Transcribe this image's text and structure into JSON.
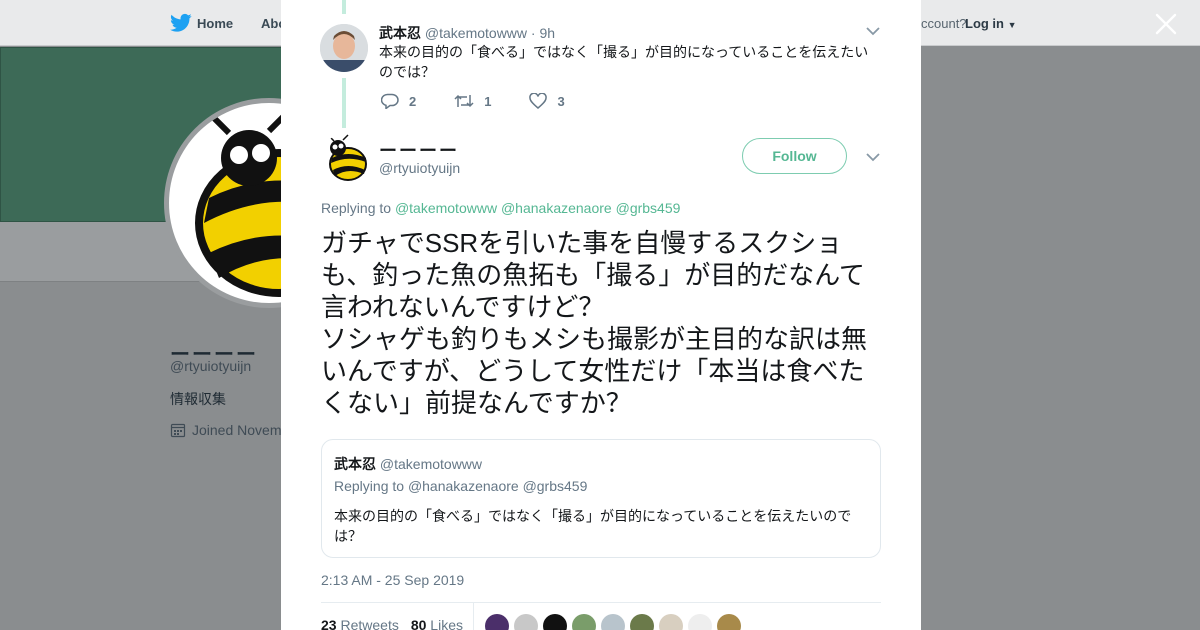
{
  "background": {
    "nav": {
      "home": "Home",
      "about": "Abo",
      "account_prompt": "ccount?",
      "login": "Log in"
    },
    "profile": {
      "name": "ーーーー",
      "handle": "@rtyuiotyuijn",
      "bio": "情報収集",
      "joined": "Joined Novem"
    }
  },
  "modal": {
    "parent_tweet": {
      "name": "武本忍",
      "handle": "@takemotowww",
      "time": "· 9h",
      "text": "本来の目的の「食べる」ではなく「撮る」が目的になっていることを伝えたいのでは？",
      "replies": "2",
      "retweets": "1",
      "likes": "3"
    },
    "tweet": {
      "name": "ーーーー",
      "handle": "@rtyuiotyuijn",
      "follow_label": "Follow",
      "replying_prefix": "Replying to",
      "replying_to": [
        "@takemotowww",
        "@hanakazenaore",
        "@grbs459"
      ],
      "text_line1": "ガチャでSSRを引いた事を自慢するスクショも、釣った魚の魚拓も「撮る」が目的だなんて言われないんですけど？",
      "text_line2": "ソシャゲも釣りもメシも撮影が主目的な訳は無いんですが、どうして女性だけ「本当は食べたくない」前提なんですか？",
      "quote": {
        "name": "武本忍",
        "handle": "@takemotowww",
        "replying_prefix": "Replying to",
        "replying_to": "@hanakazenaore @grbs459",
        "text": "本来の目的の「食べる」ではなく「撮る」が目的になっていることを伝えたいのでは？"
      },
      "timestamp": "2:13 AM - 25 Sep 2019",
      "retweet_count": "23",
      "retweet_label": "Retweets",
      "like_count": "80",
      "like_label": "Likes",
      "liker_avatars": [
        "avatar-1",
        "avatar-2",
        "avatar-3",
        "avatar-4",
        "avatar-5",
        "avatar-6",
        "avatar-7",
        "avatar-8",
        "avatar-9"
      ]
    }
  },
  "colors": {
    "accent": "#55b793",
    "thread": "#c4ecdd",
    "banner": "#3d6a57"
  }
}
